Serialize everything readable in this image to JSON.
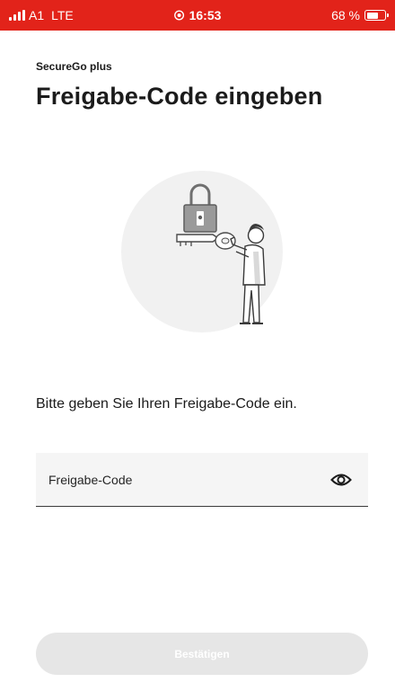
{
  "status_bar": {
    "carrier": "A1",
    "network": "LTE",
    "time": "16:53",
    "battery": "68 %",
    "battery_level": 0.68,
    "background_color": "#e2231a"
  },
  "header": {
    "app_name": "SecureGo plus",
    "title": "Freigabe-Code eingeben"
  },
  "main": {
    "illustration_icon": "person-with-key-and-padlock-illustration",
    "instruction": "Bitte geben Sie Ihren Freigabe-Code ein.",
    "code_field": {
      "placeholder": "Freigabe-Code",
      "value": "",
      "toggle_icon": "eye-icon"
    }
  },
  "footer": {
    "confirm_label": "Bestätigen",
    "confirm_disabled": true,
    "confirm_color": "#e6e6e6"
  }
}
